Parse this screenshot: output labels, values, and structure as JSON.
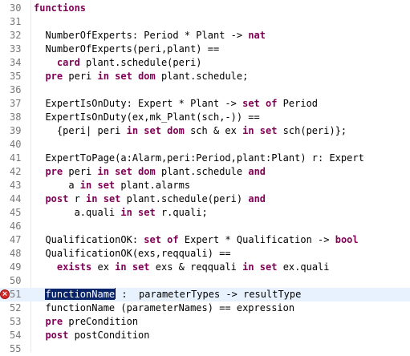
{
  "colors": {
    "keyword": "#7f0055",
    "text": "#000000",
    "line_number": "#787878",
    "current_line": "#e8f2fe",
    "selection": "#0a246a",
    "error": "#d62a2a"
  },
  "editor": {
    "lines": [
      {
        "number": "30",
        "tokens": [
          {
            "t": "functions",
            "k": true
          }
        ]
      },
      {
        "number": "31",
        "tokens": []
      },
      {
        "number": "32",
        "tokens": [
          {
            "t": "  NumberOfExperts: Period * Plant -> "
          },
          {
            "t": "nat",
            "k": true
          }
        ]
      },
      {
        "number": "33",
        "tokens": [
          {
            "t": "  NumberOfExperts(peri,plant) =="
          }
        ]
      },
      {
        "number": "34",
        "tokens": [
          {
            "t": "    "
          },
          {
            "t": "card",
            "k": true
          },
          {
            "t": " plant.schedule(peri)"
          }
        ]
      },
      {
        "number": "35",
        "tokens": [
          {
            "t": "  "
          },
          {
            "t": "pre",
            "k": true
          },
          {
            "t": " peri "
          },
          {
            "t": "in set dom",
            "k": true
          },
          {
            "t": " plant.schedule;"
          }
        ]
      },
      {
        "number": "36",
        "tokens": []
      },
      {
        "number": "37",
        "tokens": [
          {
            "t": "  ExpertIsOnDuty: Expert * Plant -> "
          },
          {
            "t": "set of",
            "k": true
          },
          {
            "t": " Period"
          }
        ]
      },
      {
        "number": "38",
        "tokens": [
          {
            "t": "  ExpertIsOnDuty(ex,mk_Plant(sch,-)) =="
          }
        ]
      },
      {
        "number": "39",
        "tokens": [
          {
            "t": "    {peri| peri "
          },
          {
            "t": "in set dom",
            "k": true
          },
          {
            "t": " sch & ex "
          },
          {
            "t": "in set",
            "k": true
          },
          {
            "t": " sch(peri)};"
          }
        ]
      },
      {
        "number": "40",
        "tokens": []
      },
      {
        "number": "41",
        "tokens": [
          {
            "t": "  ExpertToPage(a:Alarm,peri:Period,plant:Plant) r: Expert"
          }
        ]
      },
      {
        "number": "42",
        "tokens": [
          {
            "t": "  "
          },
          {
            "t": "pre",
            "k": true
          },
          {
            "t": " peri "
          },
          {
            "t": "in set dom",
            "k": true
          },
          {
            "t": " plant.schedule "
          },
          {
            "t": "and",
            "k": true
          }
        ]
      },
      {
        "number": "43",
        "tokens": [
          {
            "t": "      a "
          },
          {
            "t": "in set",
            "k": true
          },
          {
            "t": " plant.alarms"
          }
        ]
      },
      {
        "number": "44",
        "tokens": [
          {
            "t": "  "
          },
          {
            "t": "post",
            "k": true
          },
          {
            "t": " r "
          },
          {
            "t": "in set",
            "k": true
          },
          {
            "t": " plant.schedule(peri) "
          },
          {
            "t": "and",
            "k": true
          }
        ]
      },
      {
        "number": "45",
        "tokens": [
          {
            "t": "       a.quali "
          },
          {
            "t": "in set",
            "k": true
          },
          {
            "t": " r.quali;"
          }
        ]
      },
      {
        "number": "46",
        "tokens": []
      },
      {
        "number": "47",
        "tokens": [
          {
            "t": "  QualificationOK: "
          },
          {
            "t": "set of",
            "k": true
          },
          {
            "t": " Expert * Qualification -> "
          },
          {
            "t": "bool",
            "k": true
          }
        ]
      },
      {
        "number": "48",
        "tokens": [
          {
            "t": "  QualificationOK(exs,reqquali) =="
          }
        ]
      },
      {
        "number": "49",
        "tokens": [
          {
            "t": "    "
          },
          {
            "t": "exists",
            "k": true
          },
          {
            "t": " ex "
          },
          {
            "t": "in set",
            "k": true
          },
          {
            "t": " exs & reqquali "
          },
          {
            "t": "in set",
            "k": true
          },
          {
            "t": " ex.quali"
          }
        ]
      },
      {
        "number": "50",
        "tokens": []
      },
      {
        "number": "51",
        "error": true,
        "current": true,
        "tokens": [
          {
            "t": "  "
          },
          {
            "t": "functionName",
            "sel": true
          },
          {
            "t": " :  parameterTypes -> resultType"
          }
        ]
      },
      {
        "number": "52",
        "tokens": [
          {
            "t": "  functionName (parameterNames) == expression"
          }
        ]
      },
      {
        "number": "53",
        "tokens": [
          {
            "t": "  "
          },
          {
            "t": "pre",
            "k": true
          },
          {
            "t": " preCondition"
          }
        ]
      },
      {
        "number": "54",
        "tokens": [
          {
            "t": "  "
          },
          {
            "t": "post",
            "k": true
          },
          {
            "t": " postCondition"
          }
        ]
      },
      {
        "number": "55",
        "tokens": []
      }
    ]
  }
}
